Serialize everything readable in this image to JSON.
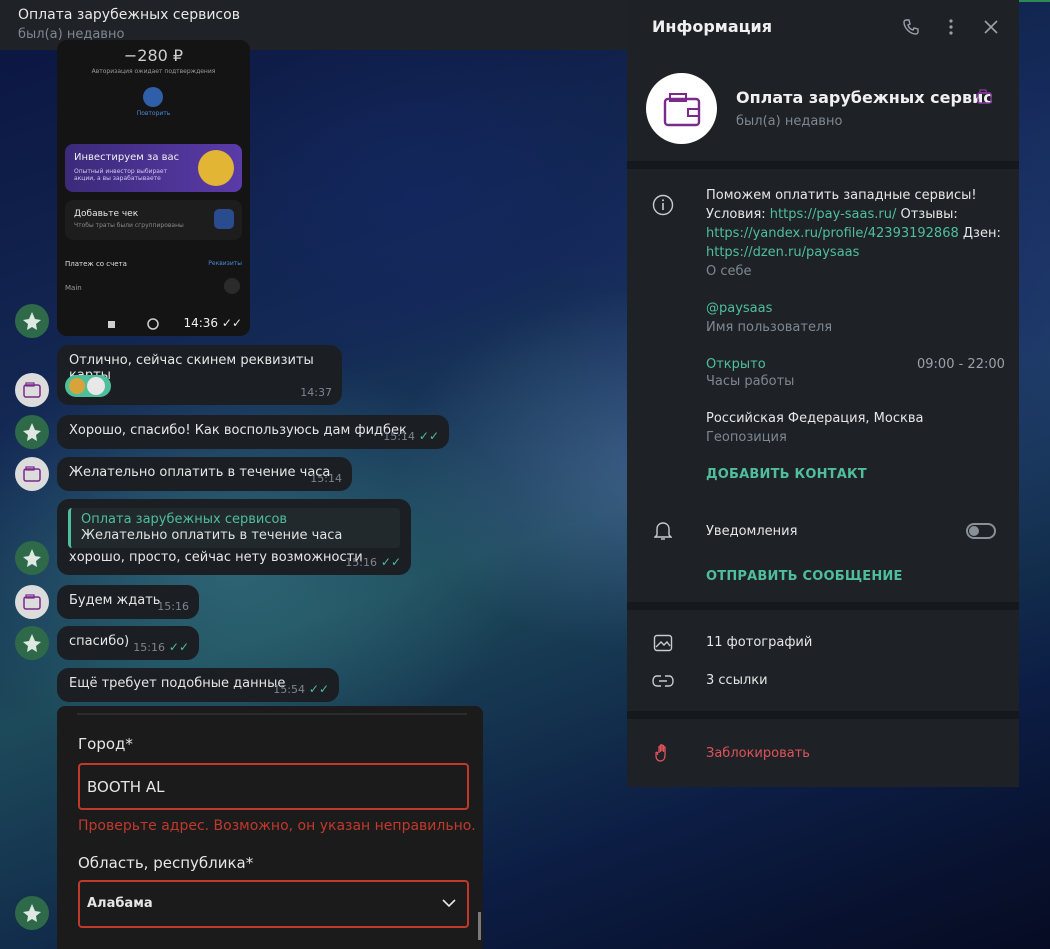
{
  "chat": {
    "title": "Оплата зарубежных сервисов",
    "status": "был(а) недавно"
  },
  "screenshot_image": {
    "amount": "−280 ₽",
    "auth_text": "Авторизация ожидает подтверждения",
    "repeat_label": "Повторить",
    "promo_title": "Инвестируем за вас",
    "promo_sub": "Опытный инвестор выбирает акции, а вы зарабатываете",
    "check_title": "Добавьте чек",
    "check_sub": "Чтобы траты были сгруппированы",
    "payment_label": "Платеж со счета",
    "requisites_label": "Реквизиты",
    "account_label": "Main",
    "time": "14:36"
  },
  "messages": [
    {
      "text": "Отлично, сейчас скинем реквизиты карты",
      "time": "14:37"
    },
    {
      "text": "Хорошо, спасибо! Как воспользуюсь дам фидбек",
      "time": "15:14"
    },
    {
      "text": "Желательно оплатить в течение часа",
      "time": "15:14"
    },
    {
      "reply_name": "Оплата зарубежных сервисов",
      "reply_text": "Желательно оплатить в течение часа",
      "text": "хорошо, просто, сейчас нету возможности",
      "time": "15:16"
    },
    {
      "text": "Будем ждать",
      "time": "15:16"
    },
    {
      "text": "спасибо)",
      "time": "15:16"
    },
    {
      "text": "Ещё требует подобные данные",
      "time": "15:54"
    }
  ],
  "form_image": {
    "city_label": "Город*",
    "city_value": "BOOTH AL",
    "error": "Проверьте адрес. Возможно, он указан неправильно.",
    "region_label": "Область, республика*",
    "region_value": "Алабама"
  },
  "panel": {
    "title": "Информация",
    "name": "Оплата зарубежных сервис",
    "status": "был(а) недавно",
    "bio_line1": "Поможем оплатить западные сервисы!",
    "bio_conditions": "Условия:",
    "bio_link1": "https://pay-saas.ru/",
    "bio_reviews": "Отзывы:",
    "bio_link2": "https://yandex.ru/profile/42393192868",
    "bio_dzen": "Дзен:",
    "bio_link3": "https://dzen.ru/paysaas",
    "bio_label": "О себе",
    "username": "@paysaas",
    "username_label": "Имя пользователя",
    "hours_status": "Открыто",
    "hours_range": "09:00 - 22:00",
    "hours_label": "Часы работы",
    "location": "Российская Федерация, Москва",
    "location_label": "Геопозиция",
    "add_contact": "ДОБАВИТЬ КОНТАКТ",
    "notifications": "Уведомления",
    "send_message": "ОТПРАВИТЬ СООБЩЕНИЕ",
    "photos": "11 фотографий",
    "links": "3 ссылки",
    "block": "Заблокировать"
  },
  "colors": {
    "accent": "#4fbe9b",
    "danger": "#e0525a",
    "error": "#c0392b",
    "panel_bg": "#1e2227"
  }
}
